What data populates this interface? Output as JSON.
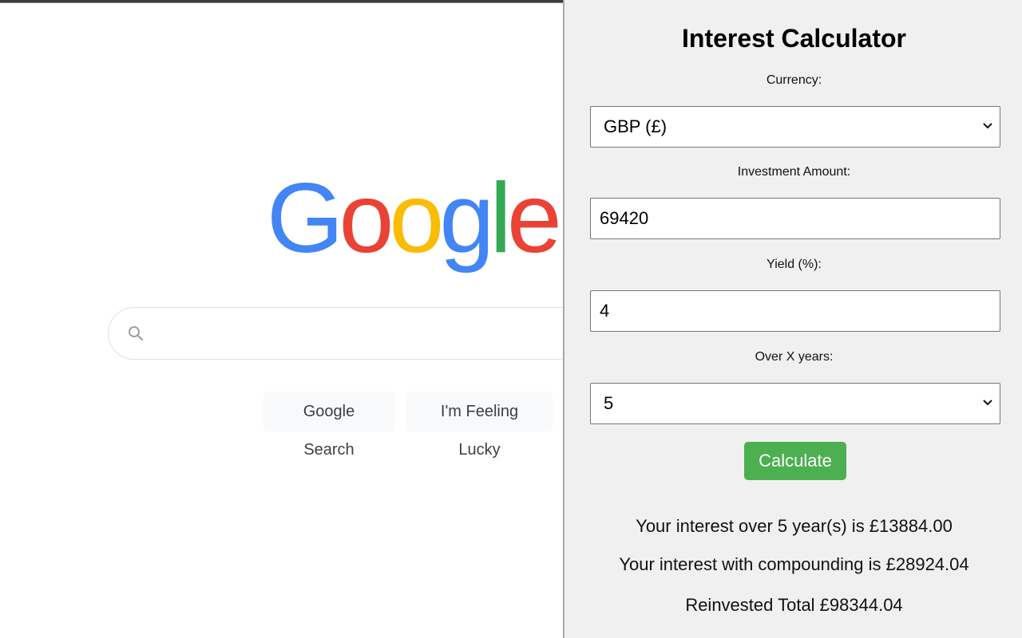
{
  "google": {
    "logo_letters": [
      {
        "char": "G",
        "color": "#4285f4"
      },
      {
        "char": "o",
        "color": "#ea4335"
      },
      {
        "char": "o",
        "color": "#fbbc05"
      },
      {
        "char": "g",
        "color": "#4285f4"
      },
      {
        "char": "l",
        "color": "#34a853"
      },
      {
        "char": "e",
        "color": "#ea4335"
      }
    ],
    "search_value": "",
    "search_button_label": "Google Search",
    "lucky_button_label": "I'm Feeling Lucky"
  },
  "calculator": {
    "title": "Interest Calculator",
    "currency_label": "Currency:",
    "currency_value": "GBP (£)",
    "amount_label": "Investment Amount:",
    "amount_value": "69420",
    "yield_label": "Yield (%):",
    "yield_value": "4",
    "years_label": "Over X years:",
    "years_value": "5",
    "calculate_label": "Calculate",
    "accent_color": "#4caf50",
    "results": {
      "simple": "Your interest over 5 year(s) is £13884.00",
      "compound": "Your interest with compounding is £28924.04",
      "total": "Reinvested Total £98344.04"
    }
  }
}
